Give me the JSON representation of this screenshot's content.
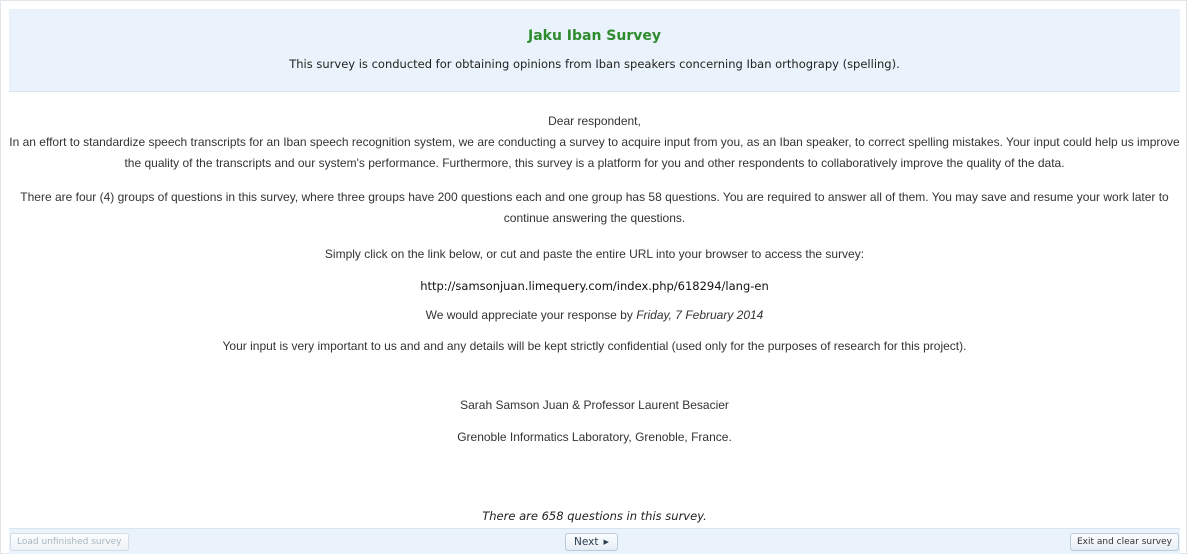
{
  "survey": {
    "title": "Jaku Iban Survey",
    "description": "This survey is conducted for obtaining opinions from Iban speakers concerning Iban orthograpy (spelling)."
  },
  "welcome": {
    "greeting": "Dear respondent,",
    "intro": "In an effort to standardize speech transcripts for an Iban speech recognition system, we are conducting a survey to acquire input from you, as an Iban speaker, to correct spelling mistakes. Your input could help us improve the quality of the transcripts and our system's performance. Furthermore, this survey is a platform for you and other respondents to collaboratively improve the quality of the data.",
    "groups": "There are four (4) groups of questions in this survey, where three groups have 200 questions each and one group has 58 questions. You are required to answer all of them. You may save and resume your work later to continue answering the questions.",
    "click_instruction": "Simply click on the link below, or cut and paste the entire URL into your browser to access the survey:",
    "url": "http://samsonjuan.limequery.com/index.php/618294/lang-en",
    "appreciate_prefix": "We would appreciate your response by ",
    "deadline": "Friday, 7 February 2014",
    "confidential": "Your input is very important to us and and any details will be kept strictly confidential (used only for the purposes of research for this project).",
    "authors": "Sarah Samson Juan & Professor Laurent Besacier",
    "affiliation": "Grenoble Informatics Laboratory, Grenoble, France.",
    "question_count": "There are 658 questions in this survey."
  },
  "nav": {
    "load_label": "Load unfinished survey",
    "next_label": "Next",
    "next_icon": "triangle-right-icon",
    "exit_label": "Exit and clear survey"
  },
  "colors": {
    "title": "#2e8b2e",
    "header_bg": "#eaf3fb"
  }
}
